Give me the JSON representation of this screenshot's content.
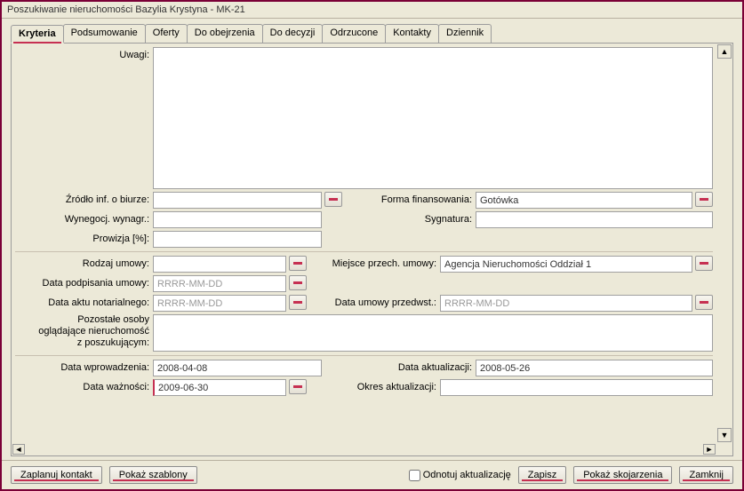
{
  "window": {
    "title": "Poszukiwanie nieruchomości Bazylia Krystyna - MK-21"
  },
  "tabs": [
    {
      "label": "Kryteria",
      "active": true
    },
    {
      "label": "Podsumowanie"
    },
    {
      "label": "Oferty"
    },
    {
      "label": "Do obejrzenia"
    },
    {
      "label": "Do decyzji"
    },
    {
      "label": "Odrzucone"
    },
    {
      "label": "Kontakty"
    },
    {
      "label": "Dziennik"
    }
  ],
  "form": {
    "uwagi": {
      "label": "Uwagi:",
      "value": ""
    },
    "zrodlo_inf": {
      "label": "Źródło inf. o biurze:",
      "value": ""
    },
    "forma_finansowania": {
      "label": "Forma finansowania:",
      "value": "Gotówka"
    },
    "wynegocj": {
      "label": "Wynegocj. wynagr.:",
      "value": ""
    },
    "sygnatura": {
      "label": "Sygnatura:",
      "value": ""
    },
    "prowizja": {
      "label": "Prowizja [%]:",
      "value": ""
    },
    "rodzaj_umowy": {
      "label": "Rodzaj umowy:",
      "value": ""
    },
    "miejsce_przech": {
      "label": "Miejsce przech. umowy:",
      "value": "Agencja Nieruchomości Oddział 1"
    },
    "data_podpisania": {
      "label": "Data podpisania umowy:",
      "value": "",
      "placeholder": "RRRR-MM-DD"
    },
    "data_aktu": {
      "label": "Data aktu notarialnego:",
      "value": "",
      "placeholder": "RRRR-MM-DD"
    },
    "data_umowy_przedwst": {
      "label": "Data umowy przedwst.:",
      "value": "",
      "placeholder": "RRRR-MM-DD"
    },
    "pozostale_osoby": {
      "label_l1": "Pozostałe osoby",
      "label_l2": "oglądające nieruchomość",
      "label_l3": "z poszukującym:",
      "value": ""
    },
    "data_wprowadzenia": {
      "label": "Data wprowadzenia:",
      "value": "2008-04-08"
    },
    "data_aktualizacji": {
      "label": "Data aktualizacji:",
      "value": "2008-05-26"
    },
    "data_waznosci": {
      "label": "Data ważności:",
      "value": "2009-06-30"
    },
    "okres_aktualizacji": {
      "label": "Okres aktualizacji:",
      "value": ""
    }
  },
  "bottom": {
    "zaplanuj_kontakt": "Zaplanuj kontakt",
    "pokaz_szablony": "Pokaż szablony",
    "odnotuj_checkbox": "Odnotuj aktualizację",
    "zapisz": "Zapisz",
    "pokaz_skojarzenia": "Pokaż skojarzenia",
    "zamknij": "Zamknij"
  }
}
